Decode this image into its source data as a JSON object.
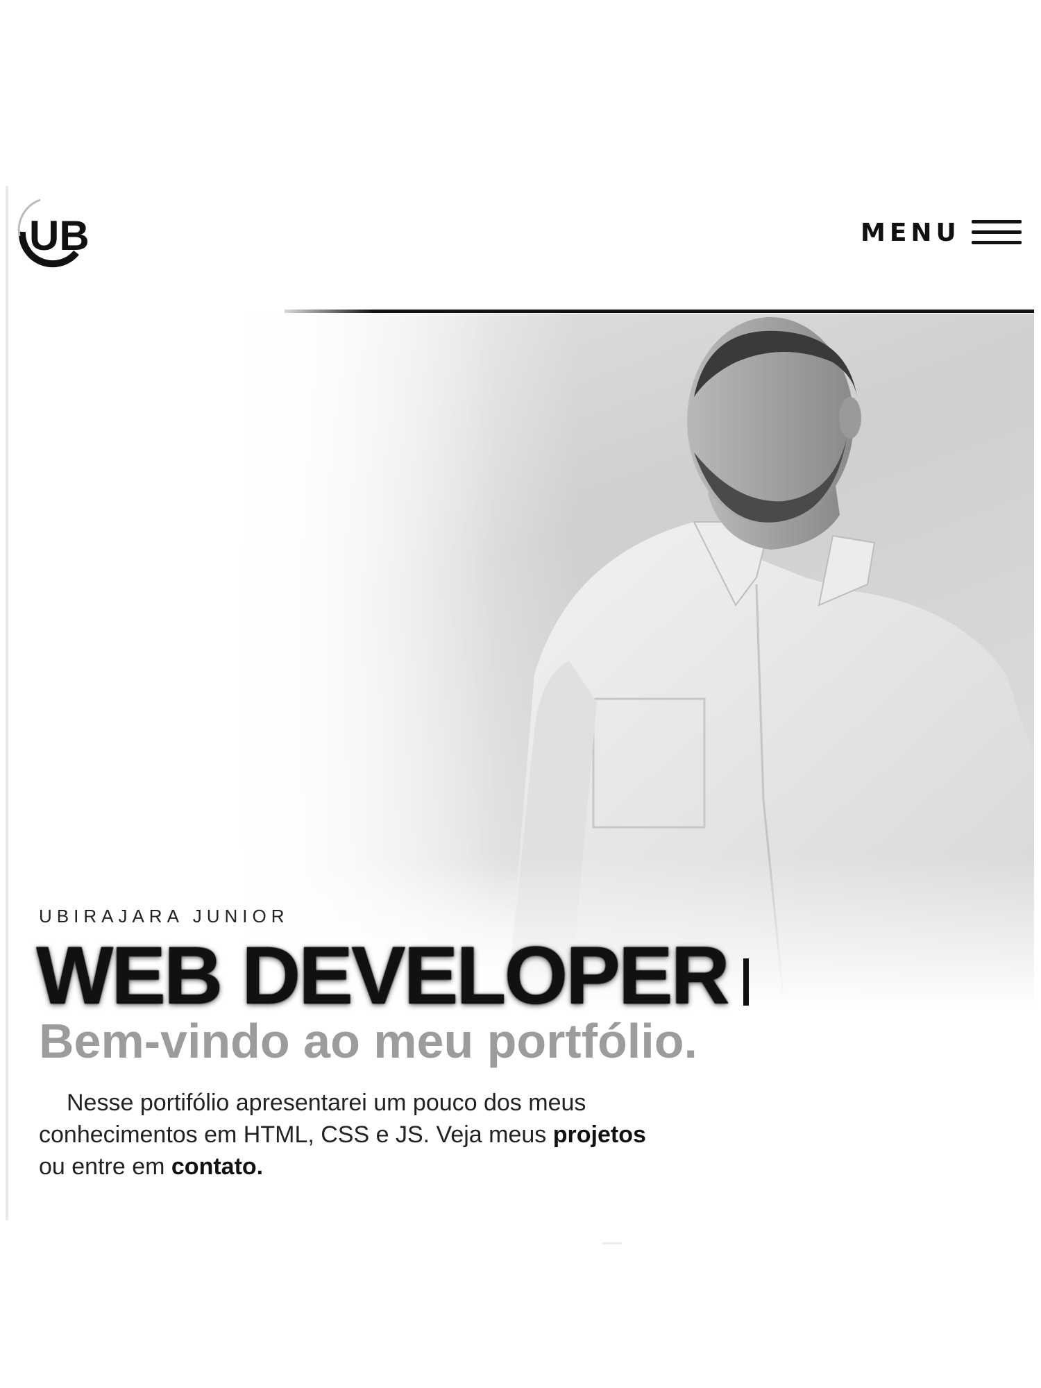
{
  "header": {
    "logo_text": "UB",
    "menu_label": "MENU"
  },
  "hero": {
    "subtitle": "UBIRAJARA JUNIOR",
    "headline": "WEB DEVELOPER",
    "welcome": "Bem-vindo ao meu portfólio.",
    "intro": {
      "line1": "Nesse portifólio apresentarei um pouco dos meus",
      "line2_text": "conhecimentos em HTML, CSS e JS. Veja meus ",
      "projects_link": "projetos",
      "line3_text": "ou entre em ",
      "contact_link": "contato."
    }
  },
  "icons": {
    "menu": "hamburger-icon",
    "logo": "ub-logo"
  },
  "colors": {
    "text_dark": "#111111",
    "welcome_gray": "#9c9c9c",
    "background": "#ffffff"
  }
}
